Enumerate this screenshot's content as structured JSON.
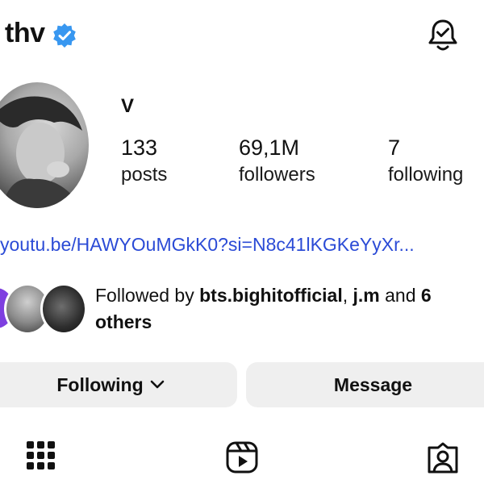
{
  "profile": {
    "username": "thv",
    "display_name": "V",
    "link": "youtu.be/HAWYOuMGkK0?si=N8c41lKGKeYyXr...",
    "stats": {
      "posts_value": "133",
      "posts_label": "posts",
      "followers_value": "69,1M",
      "followers_label": "followers",
      "following_value": "7",
      "following_label": "following"
    },
    "followed_by": {
      "prefix": "Followed by ",
      "user1": "bts.bighitofficial",
      "sep": ", ",
      "user2": "j.m",
      "and_text": " and ",
      "count": "6",
      "others": "others"
    }
  },
  "buttons": {
    "following": "Following",
    "message": "Message"
  },
  "icons": {
    "verified": "verified-badge-icon",
    "bell": "notification-bell-icon",
    "chevron": "chevron-down-icon",
    "grid": "posts-grid-icon",
    "reels": "reels-icon",
    "tagged": "tagged-icon"
  },
  "colors": {
    "verified": "#3897f0",
    "link": "#2b4bd6",
    "button_bg": "#efefef",
    "text": "#111111"
  }
}
